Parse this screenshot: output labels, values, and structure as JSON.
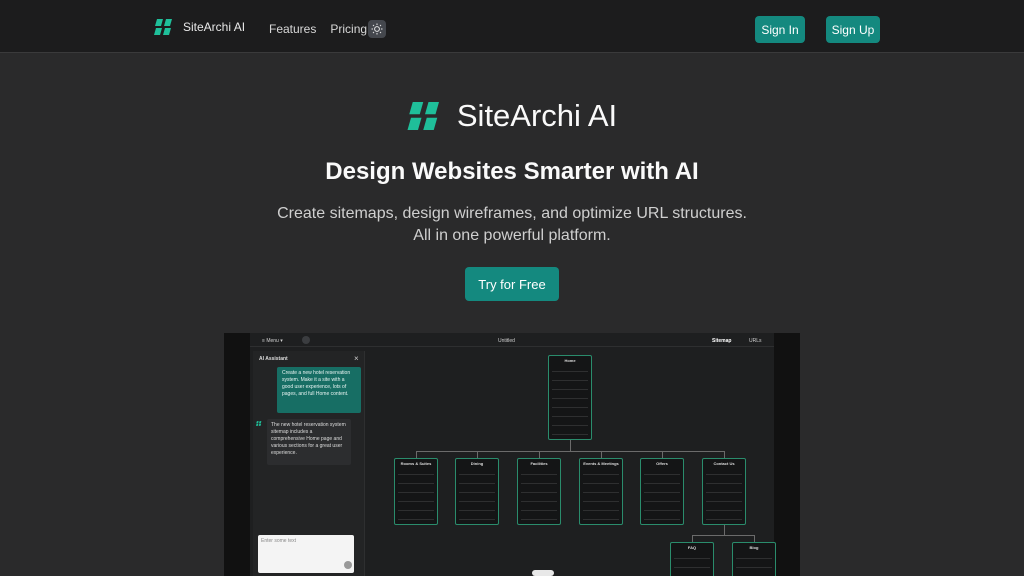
{
  "header": {
    "brand": "SiteArchi AI",
    "nav": [
      "Features",
      "Pricing"
    ],
    "theme_icon": "sun-icon",
    "sign_in": "Sign In",
    "sign_up": "Sign Up"
  },
  "hero": {
    "brand": "SiteArchi AI",
    "headline": "Design Websites Smarter with AI",
    "subline_1": "Create sitemaps, design wireframes, and optimize URL structures.",
    "subline_2": "All in one powerful platform.",
    "cta": "Try for Free"
  },
  "preview": {
    "menu": "Menu",
    "doc_title": "Untitled",
    "tabs": [
      "Sitemap",
      "URLs"
    ],
    "ai_title": "AI Assistant",
    "user_msg": "Create a new hotel reservation system. Make it a site with a good user experience, lots of pages, and full Home content.",
    "ai_msg": "The new hotel reservation system sitemap includes a comprehensive Home page and various sections for a great user experience.",
    "input_placeholder": "Enter some text",
    "nodes": {
      "home": "Home",
      "rooms": "Rooms & Suites",
      "dining": "Dining",
      "facilities": "Facilities",
      "events": "Events & Meetings",
      "offers": "Offers",
      "contact": "Contact Us",
      "faq": "FAQ",
      "blog": "Blog"
    }
  },
  "colors": {
    "accent": "#14897f",
    "background": "#2a2a2b",
    "header": "#1c1c1d"
  }
}
